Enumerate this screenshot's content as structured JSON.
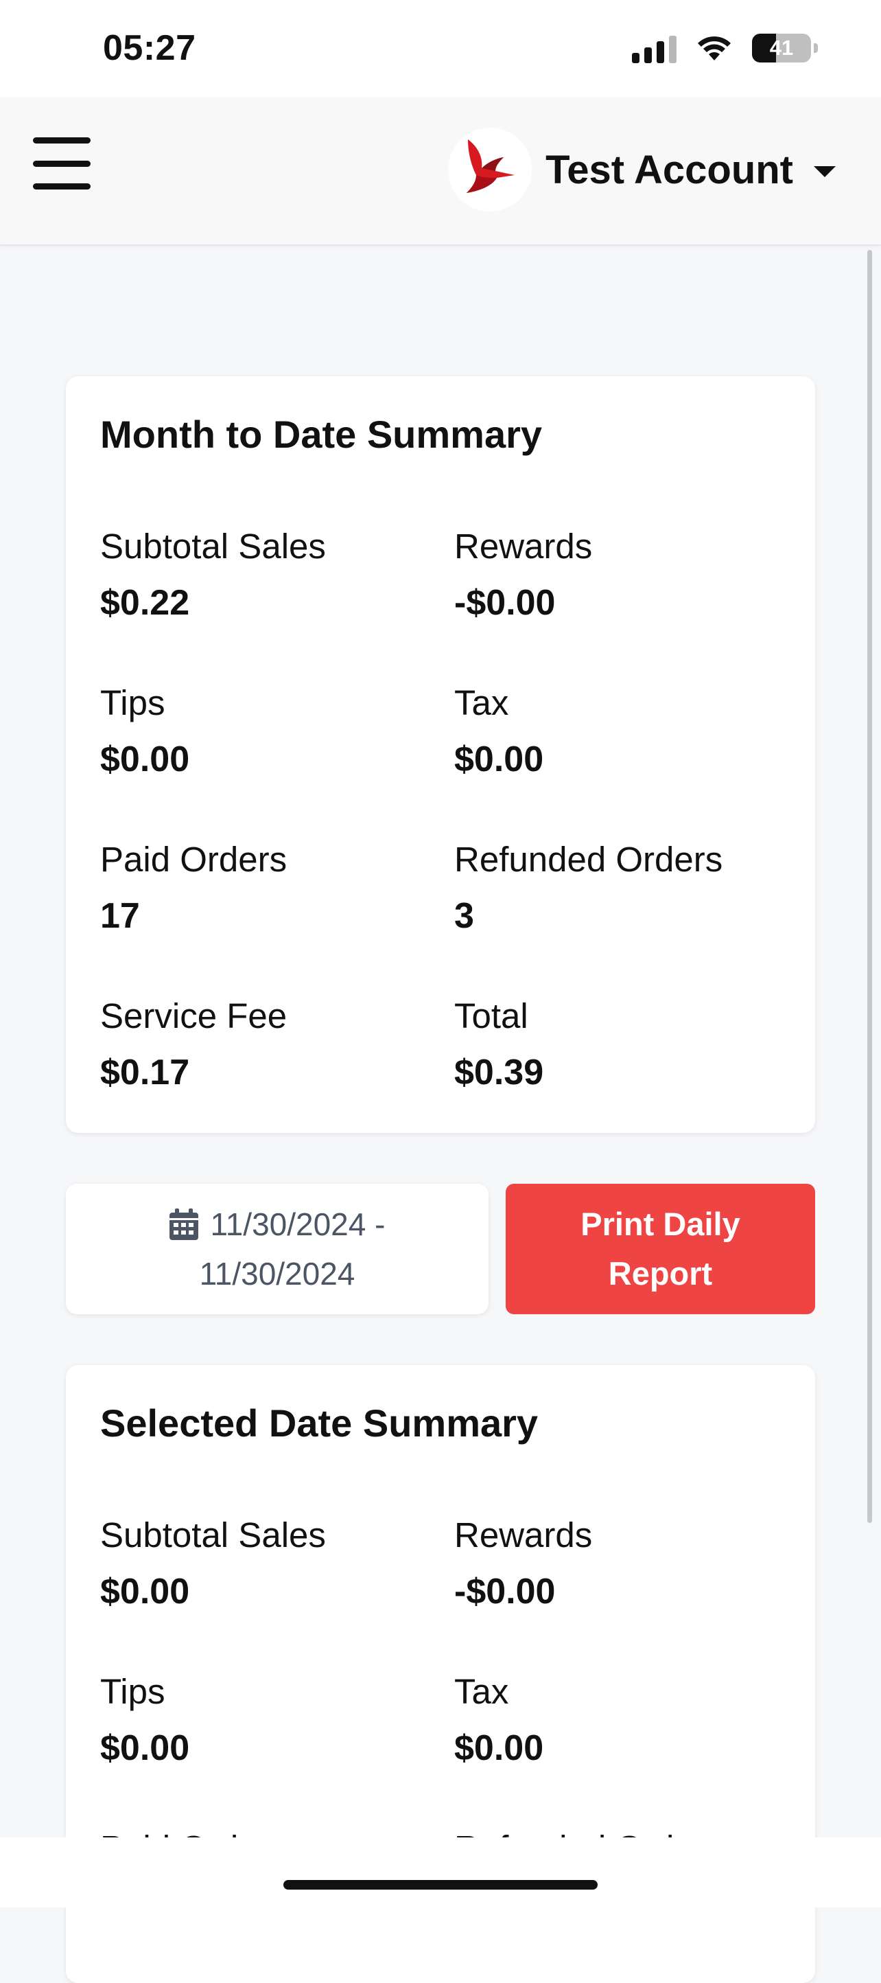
{
  "status_bar": {
    "time": "05:27",
    "battery": "41",
    "battery_level": 0.41,
    "icons": [
      "signal-icon",
      "wifi-icon",
      "battery-icon"
    ]
  },
  "header": {
    "menu_icon": "hamburger-menu-icon",
    "logo_icon": "red-bird-logo",
    "account_name": "Test Account",
    "dropdown_icon": "caret-down-icon"
  },
  "month_summary": {
    "title": "Month to Date Summary",
    "items": [
      {
        "label": "Subtotal Sales",
        "value": "$0.22"
      },
      {
        "label": "Rewards",
        "value": "-$0.00"
      },
      {
        "label": "Tips",
        "value": "$0.00"
      },
      {
        "label": "Tax",
        "value": "$0.00"
      },
      {
        "label": "Paid Orders",
        "value": "17"
      },
      {
        "label": "Refunded Orders",
        "value": "3"
      },
      {
        "label": "Service Fee",
        "value": "$0.17"
      },
      {
        "label": "Total",
        "value": "$0.39"
      }
    ]
  },
  "date_range": {
    "icon": "calendar-icon",
    "line1": "11/30/2024 -",
    "line2": "11/30/2024"
  },
  "print_button": {
    "label": "Print Daily Report"
  },
  "selected_summary": {
    "title": "Selected Date Summary",
    "items": [
      {
        "label": "Subtotal Sales",
        "value": "$0.00"
      },
      {
        "label": "Rewards",
        "value": "-$0.00"
      },
      {
        "label": "Tips",
        "value": "$0.00"
      },
      {
        "label": "Tax",
        "value": "$0.00"
      },
      {
        "label": "Paid Orders",
        "value": ""
      },
      {
        "label": "Refunded Orders",
        "value": ""
      }
    ]
  },
  "colors": {
    "accent_red": "#ef4444",
    "logo_red": "#d71920",
    "background": "#f6f7f9"
  }
}
